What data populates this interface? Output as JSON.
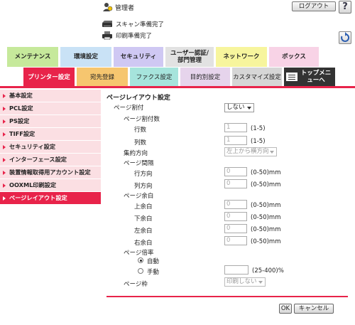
{
  "header": {
    "user": "管理者",
    "logout": "ログアウト",
    "help": "?",
    "status": [
      {
        "icon": "scanner-icon",
        "text": "スキャン準備完了"
      },
      {
        "icon": "printer-icon",
        "text": "印刷準備完了"
      }
    ]
  },
  "top_tabs": [
    {
      "label": "メンテナンス",
      "color": "#c6e99b"
    },
    {
      "label": "環境設定",
      "color": "#c9e2f6"
    },
    {
      "label": "セキュリティ",
      "color": "#cfc8f3"
    },
    {
      "label": "ユーザー認証/部門管理",
      "color": "#e2e2e2"
    },
    {
      "label": "ネットワーク",
      "color": "#f7f59d"
    },
    {
      "label": "ボックス",
      "color": "#f8d3e6"
    }
  ],
  "sub_tabs": [
    {
      "label": "プリンター設定",
      "color": "#e8234a"
    },
    {
      "label": "宛先登録",
      "color": "#f6c66f"
    },
    {
      "label": "ファクス設定",
      "color": "#a6e4dc"
    },
    {
      "label": "目的別設定",
      "color": "#e6d4ec"
    },
    {
      "label": "カスタマイズ設定",
      "color": "#d6d6d6"
    },
    {
      "label": "トップメニューへ",
      "color": "#333333"
    }
  ],
  "sidebar": {
    "items": [
      {
        "label": "基本設定"
      },
      {
        "label": "PCL設定"
      },
      {
        "label": "PS設定"
      },
      {
        "label": "TIFF設定"
      },
      {
        "label": "セキュリティ設定"
      },
      {
        "label": "インターフェース設定"
      },
      {
        "label": "装置情報取得用アカウント設定"
      },
      {
        "label": "OOXML印刷設定"
      },
      {
        "label": "ページレイアウト設定"
      }
    ],
    "active_index": 8
  },
  "form": {
    "title": "ページレイアウト設定",
    "page_split": {
      "label": "ページ割付",
      "value": "しない"
    },
    "split_count": {
      "label": "ページ割付数"
    },
    "rows": {
      "label": "行数",
      "value": "1",
      "range": "(1-5)"
    },
    "cols": {
      "label": "列数",
      "value": "1",
      "range": "(1-5)"
    },
    "direction": {
      "label": "集約方向",
      "value": "左上から横方向"
    },
    "spacing": {
      "label": "ページ間隔"
    },
    "row_spacing": {
      "label": "行方向",
      "value": "0",
      "range": "(0-50)mm"
    },
    "col_spacing": {
      "label": "列方向",
      "value": "0",
      "range": "(0-50)mm"
    },
    "margin": {
      "label": "ページ余白"
    },
    "margin_top": {
      "label": "上余白",
      "value": "0",
      "range": "(0-50)mm"
    },
    "margin_bottom": {
      "label": "下余白",
      "value": "0",
      "range": "(0-50)mm"
    },
    "margin_left": {
      "label": "左余白",
      "value": "0",
      "range": "(0-50)mm"
    },
    "margin_right": {
      "label": "右余白",
      "value": "0",
      "range": "(0-50)mm"
    },
    "scale": {
      "label": "ページ倍率",
      "auto": "自動",
      "manual": "手動",
      "manual_value": "",
      "range": "(25-400)%",
      "selected": "auto"
    },
    "frame": {
      "label": "ページ枠",
      "value": "印刷しない"
    }
  },
  "buttons": {
    "ok": "OK",
    "cancel": "キャンセル"
  },
  "colors": {
    "accent": "#e8234a",
    "sidebar_bg": "#fbdfe3"
  }
}
